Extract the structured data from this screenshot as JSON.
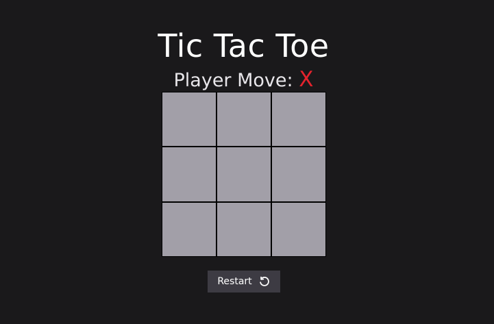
{
  "title": "Tic Tac Toe",
  "status": {
    "label": "Player Move:",
    "player": "X",
    "player_color": "#e5232d"
  },
  "board": {
    "cells": [
      "",
      "",
      "",
      "",
      "",
      "",
      "",
      "",
      ""
    ],
    "cell_color": "#a29fa8"
  },
  "restart": {
    "label": "Restart",
    "icon": "restart-icon"
  },
  "colors": {
    "background": "#1a191b",
    "button": "#3d3b43",
    "text": "#ffffff"
  }
}
